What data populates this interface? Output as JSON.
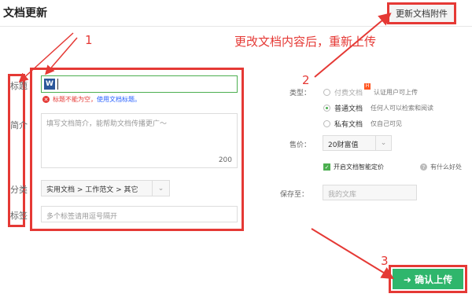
{
  "header": {
    "title": "文档更新",
    "update_attachment_button": "更新文档附件"
  },
  "annotations": {
    "num1": "1",
    "num2": "2",
    "num3": "3",
    "instruction": "更改文档内容后，重新上传"
  },
  "form": {
    "labels": {
      "title": "标题",
      "intro": "简介",
      "category": "分类",
      "tags": "标签"
    },
    "title_input": {
      "icon": "W",
      "value": ""
    },
    "error": {
      "text": "标题不能为空，",
      "link": "使用文档标题。"
    },
    "desc_placeholder": "填写文档简介，能帮助文档传播更广～",
    "desc_count": "200",
    "category_value": "实用文档 > 工作范文 > 其它",
    "tags_placeholder": "多个标签请用逗号隔开"
  },
  "settings": {
    "type_label": "类型：",
    "types": [
      {
        "label": "付费文档",
        "desc": "认证用户可上传",
        "checked": false,
        "disabled": true,
        "badge": "H"
      },
      {
        "label": "普通文档",
        "desc": "任何人可以检索和阅读",
        "checked": true,
        "disabled": false
      },
      {
        "label": "私有文档",
        "desc": "仅自己可见",
        "checked": false,
        "disabled": false
      }
    ],
    "price_label": "售价：",
    "price_value": "20财富值",
    "smart_price": "开启文档智能定价",
    "help_text": "有什么好处",
    "save_label": "保存至：",
    "save_value": "我的文库",
    "confirm_button": "➜ 确认上传"
  },
  "colors": {
    "annotation_red": "#e53935",
    "confirm_green": "#2fb66c",
    "valid_green": "#4caf50"
  }
}
